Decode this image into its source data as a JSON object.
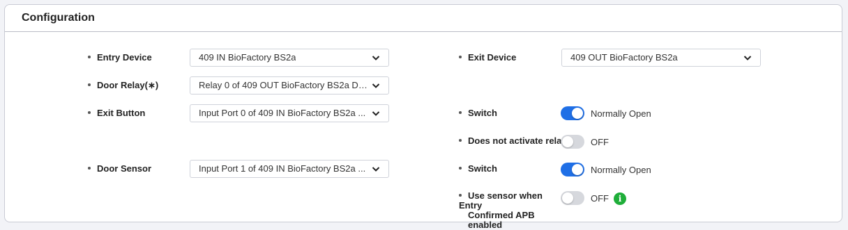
{
  "panel": {
    "title": "Configuration"
  },
  "left": {
    "entry_device": {
      "label": "Entry Device",
      "value": "409 IN BioFactory BS2a"
    },
    "door_relay": {
      "label": "Door Relay(∗)",
      "value": "Relay 0 of 409 OUT BioFactory BS2a De..."
    },
    "exit_button": {
      "label": "Exit Button",
      "value": "Input Port 0 of 409 IN BioFactory BS2a ..."
    },
    "door_sensor": {
      "label": "Door Sensor",
      "value": "Input Port 1 of 409 IN BioFactory BS2a ..."
    }
  },
  "right": {
    "exit_device": {
      "label": "Exit Device",
      "value": "409 OUT BioFactory BS2a"
    },
    "exit_button_switch": {
      "label": "Switch",
      "state": "on",
      "text": "Normally Open"
    },
    "does_not_activate_relay": {
      "label": "Does not activate rela",
      "state": "off",
      "text": "OFF"
    },
    "door_sensor_switch": {
      "label": "Switch",
      "state": "on",
      "text": "Normally Open"
    },
    "use_sensor": {
      "label_line1": "Use sensor when Entry",
      "label_line2": "Confirmed APB enabled",
      "state": "off",
      "text": "OFF",
      "info_glyph": "i"
    }
  },
  "colors": {
    "toggle_on": "#1f6fe6",
    "toggle_off": "#d6d8dd",
    "info": "#1fae3a"
  },
  "icons": {
    "dropdown": "chevron-down-icon",
    "info": "info-icon"
  }
}
